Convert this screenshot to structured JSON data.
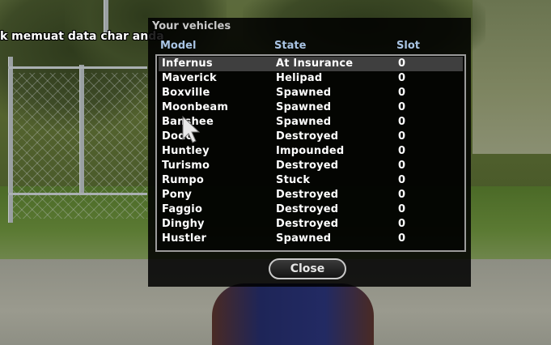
{
  "chat": {
    "line": "k memuat data char anda"
  },
  "dialog": {
    "title": "Your vehicles",
    "columns": {
      "model": "Model",
      "state": "State",
      "slot": "Slot"
    },
    "rows": [
      {
        "model": "Infernus",
        "state": "At Insurance",
        "slot": "0"
      },
      {
        "model": "Maverick",
        "state": "Helipad",
        "slot": "0"
      },
      {
        "model": "Boxville",
        "state": "Spawned",
        "slot": "0"
      },
      {
        "model": "Moonbeam",
        "state": "Spawned",
        "slot": "0"
      },
      {
        "model": "Banshee",
        "state": "Spawned",
        "slot": "0"
      },
      {
        "model": "Dodo",
        "state": "Destroyed",
        "slot": "0"
      },
      {
        "model": "Huntley",
        "state": "Impounded",
        "slot": "0"
      },
      {
        "model": "Turismo",
        "state": "Destroyed",
        "slot": "0"
      },
      {
        "model": "Rumpo",
        "state": "Stuck",
        "slot": "0"
      },
      {
        "model": "Pony",
        "state": "Destroyed",
        "slot": "0"
      },
      {
        "model": "Faggio",
        "state": "Destroyed",
        "slot": "0"
      },
      {
        "model": "Dinghy",
        "state": "Destroyed",
        "slot": "0"
      },
      {
        "model": "Hustler",
        "state": "Spawned",
        "slot": "0"
      }
    ],
    "selected_index": 0,
    "close_label": "Close"
  },
  "colors": {
    "header": "#a9c4e4",
    "row_text": "#ffffff",
    "selected_row": "#3f3f3f",
    "dialog_bg": "#000000"
  },
  "icons": {
    "cursor": "mouse-pointer-icon"
  }
}
